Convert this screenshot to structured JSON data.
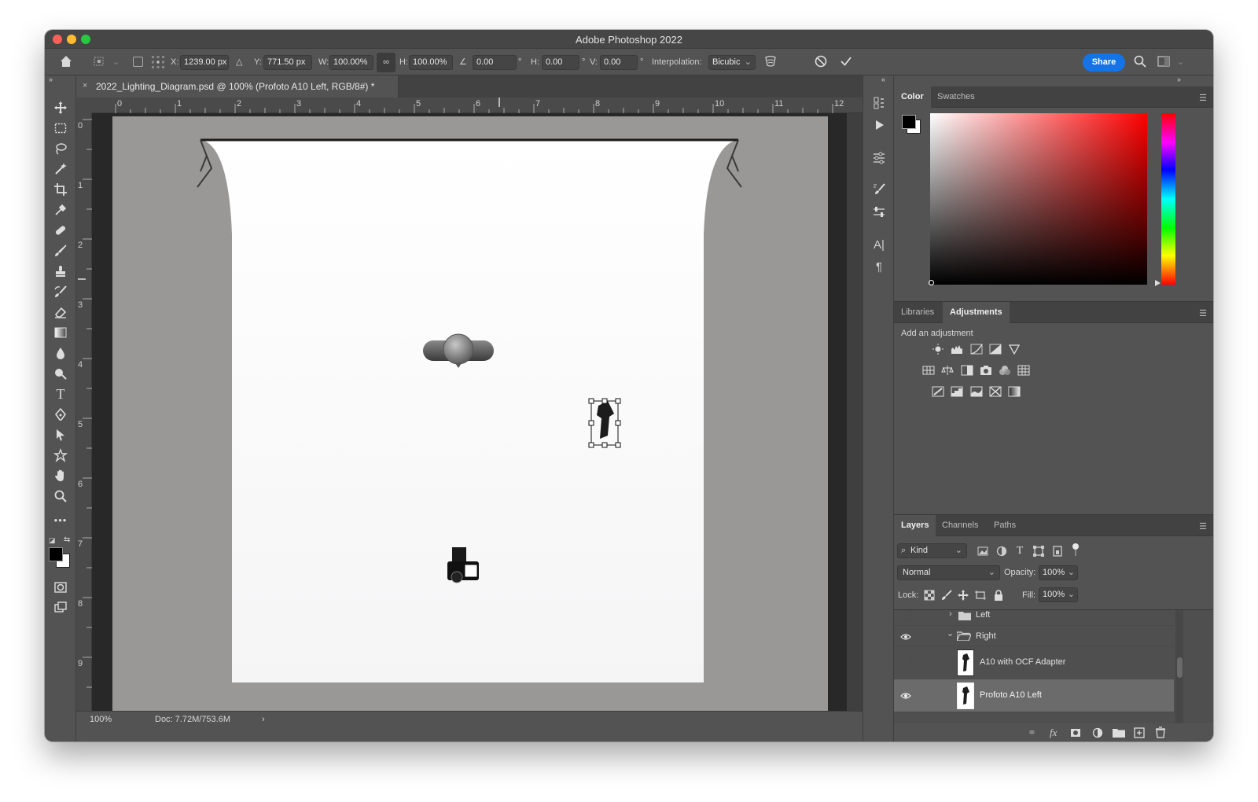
{
  "app": {
    "title": "Adobe Photoshop 2022"
  },
  "options_bar": {
    "x_label": "X:",
    "x_value": "1239.00 px",
    "y_label": "Y:",
    "y_value": "771.50 px",
    "w_label": "W:",
    "w_value": "100.00%",
    "h_label": "H:",
    "h_value": "100.00%",
    "angle_value": "0.00",
    "degree_symbol": "°",
    "skew_h_label": "H:",
    "skew_h_value": "0.00",
    "skew_v_label": "V:",
    "skew_v_value": "0.00",
    "interpolation_label": "Interpolation:",
    "interpolation_value": "Bicubic",
    "share_label": "Share"
  },
  "document": {
    "tab_close": "×",
    "tab_title": "2022_Lighting_Diagram.psd @ 100% (Profoto A10 Left, RGB/8#) *",
    "ruler_top": [
      "0",
      "1",
      "2",
      "3",
      "4",
      "5",
      "6",
      "7",
      "8",
      "9",
      "10",
      "11",
      "12"
    ],
    "ruler_left": [
      "0",
      "1",
      "2",
      "3",
      "4",
      "5",
      "6",
      "7",
      "8",
      "9"
    ],
    "zoom": "100%",
    "doc_size": "Doc: 7.72M/753.6M",
    "status_arrow": "›"
  },
  "color_panel": {
    "tabs": [
      "Color",
      "Swatches"
    ],
    "active_tab": "Color",
    "foreground": "#000000",
    "background": "#ffffff",
    "hue": "#ff0000"
  },
  "adjustments_panel": {
    "tabs": [
      "Libraries",
      "Adjustments"
    ],
    "active_tab": "Adjustments",
    "heading": "Add an adjustment"
  },
  "layers_panel": {
    "tabs": [
      "Layers",
      "Channels",
      "Paths"
    ],
    "active_tab": "Layers",
    "filter_label": "Kind",
    "blend_mode": "Normal",
    "opacity_label": "Opacity:",
    "opacity_value": "100%",
    "lock_label": "Lock:",
    "fill_label": "Fill:",
    "fill_value": "100%",
    "layers": [
      {
        "name": "Left",
        "type": "group",
        "expanded": false,
        "visible": false
      },
      {
        "name": "Right",
        "type": "group",
        "expanded": true,
        "visible": true
      },
      {
        "name": "A10 with OCF Adapter",
        "type": "layer",
        "visible": false
      },
      {
        "name": "Profoto A10 Left",
        "type": "layer",
        "visible": true,
        "selected": true
      }
    ]
  },
  "accent_color": "#1473e6"
}
